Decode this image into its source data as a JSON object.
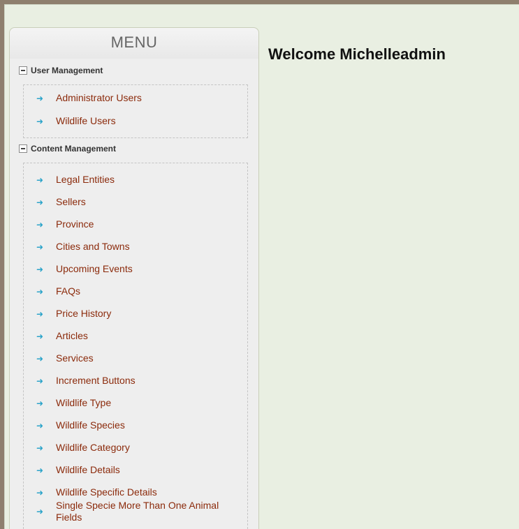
{
  "menu": {
    "title": "MENU",
    "sections": [
      {
        "title": "User Management",
        "items": [
          "Administrator Users",
          "Wildlife Users"
        ]
      },
      {
        "title": "Content Management",
        "items": [
          "Legal Entities",
          "Sellers",
          "Province",
          "Cities and Towns",
          "Upcoming Events",
          "FAQs",
          "Price History",
          "Articles",
          "Services",
          "Increment Buttons",
          "Wildlife Type",
          "Wildlife Species",
          "Wildlife Category",
          "Wildlife Details",
          "Wildlife Specific Details",
          "Single Specie More Than One Animal Fields"
        ]
      }
    ]
  },
  "main": {
    "welcome_text": "Welcome Michelleadmin"
  },
  "colors": {
    "link": "#8b2a0b",
    "arrow": "#2aa3c9",
    "page_background": "#e9efe2",
    "frame": "#8e7f6e"
  }
}
